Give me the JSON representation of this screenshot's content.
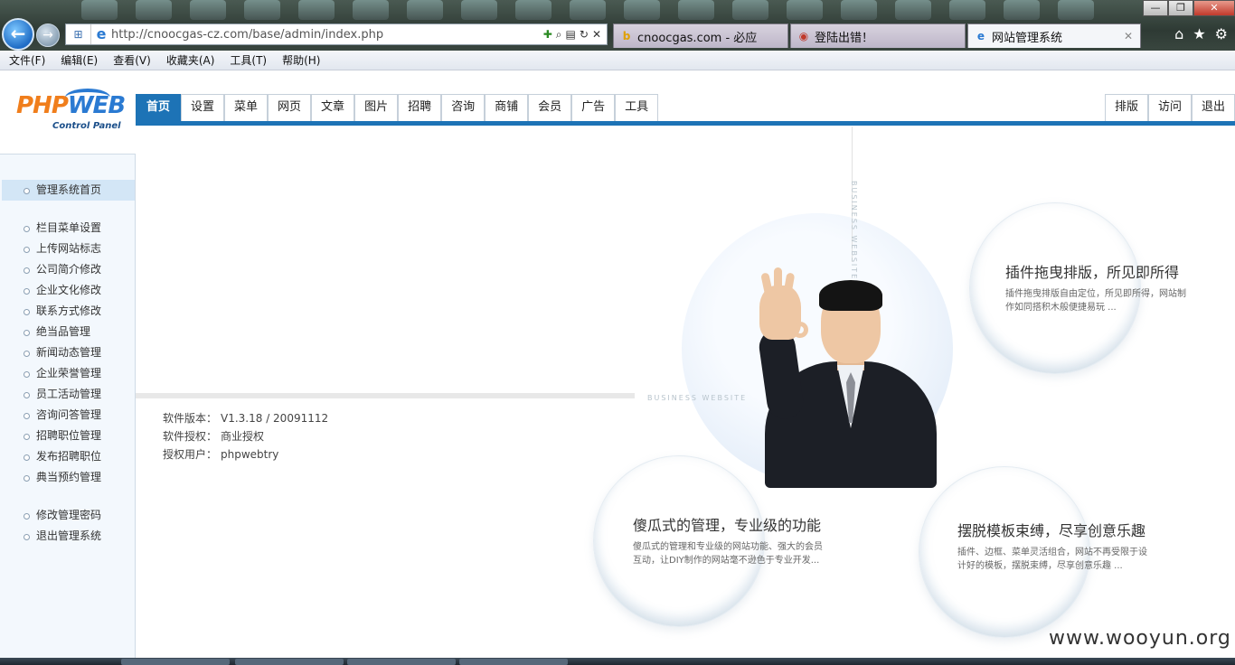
{
  "browser": {
    "url": "http://cnoocgas-cz.com/base/admin/index.php",
    "tabs": [
      {
        "label": "cnoocgas.com - 必应",
        "icon": "bing-icon"
      },
      {
        "label": "登陆出错！",
        "icon": "error-page-icon"
      },
      {
        "label": "网站管理系统",
        "icon": "ie-icon",
        "active": true
      }
    ],
    "menu": [
      "文件(F)",
      "编辑(E)",
      "查看(V)",
      "收藏夹(A)",
      "工具(T)",
      "帮助(H)"
    ]
  },
  "logo": {
    "text_php": "PHP",
    "text_web": "WEB",
    "subtitle": "Control Panel"
  },
  "topnav": {
    "items": [
      "首页",
      "设置",
      "菜单",
      "网页",
      "文章",
      "图片",
      "招聘",
      "咨询",
      "商铺",
      "会员",
      "广告",
      "工具"
    ],
    "active_index": 0,
    "right_items": [
      "排版",
      "访问",
      "退出"
    ]
  },
  "sidebar": {
    "group1": [
      "管理系统首页"
    ],
    "group2": [
      "栏目菜单设置",
      "上传网站标志",
      "公司简介修改",
      "企业文化修改",
      "联系方式修改",
      "绝当品管理",
      "新闻动态管理",
      "企业荣誉管理",
      "员工活动管理",
      "咨询问答管理",
      "招聘职位管理",
      "发布招聘职位",
      "典当预约管理"
    ],
    "group3": [
      "修改管理密码",
      "退出管理系统"
    ]
  },
  "info": {
    "version_label": "软件版本：",
    "version_value": "V1.3.18 / 20091112",
    "license_label": "软件授权：",
    "license_value": "商业授权",
    "user_label": "授权用户：",
    "user_value": "phpwebtry"
  },
  "deco_labels": {
    "vertical": "BUSINESS WEBSITE",
    "horizontal": "BUSINESS WEBSITE"
  },
  "features": {
    "top": {
      "title": "插件拖曳排版，所见即所得",
      "desc": "插件拖曳排版自由定位，所见即所得，网站制作如同搭积木般便捷易玩 ..."
    },
    "left": {
      "title": "傻瓜式的管理，专业级的功能",
      "desc": "傻瓜式的管理和专业级的网站功能、强大的会员互动，让DIY制作的网站毫不逊色于专业开发..."
    },
    "right": {
      "title": "摆脱模板束缚，尽享创意乐趣",
      "desc": "插件、边框、菜单灵活组合，网站不再受限于设计好的模板，摆脱束缚，尽享创意乐趣 ..."
    }
  },
  "watermark": "www.wooyun.org",
  "colors": {
    "accent": "#1d73b6",
    "logo_orange": "#f07e1c",
    "logo_blue": "#2a7ad2"
  }
}
